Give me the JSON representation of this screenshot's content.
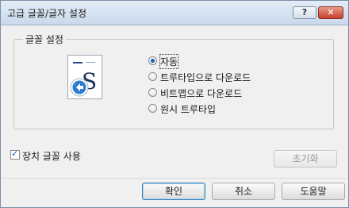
{
  "window": {
    "title": "고급 글꼴/글자 설정"
  },
  "titlebar_buttons": {
    "help": "?",
    "close": "✕"
  },
  "group": {
    "label": "글꼴 설정",
    "options": [
      {
        "label": "자동",
        "selected": true
      },
      {
        "label": "트루타입으로 다운로드",
        "selected": false
      },
      {
        "label": "비트맵으로 다운로드",
        "selected": false
      },
      {
        "label": "원시 트루타입",
        "selected": false
      }
    ]
  },
  "device_font": {
    "label": "장치 글꼴 사용",
    "checked": true
  },
  "buttons": {
    "reset": "초기화",
    "ok": "확인",
    "cancel": "취소",
    "help": "도움말"
  },
  "colors": {
    "accent": "#1f5fb8",
    "close": "#c4402a"
  }
}
